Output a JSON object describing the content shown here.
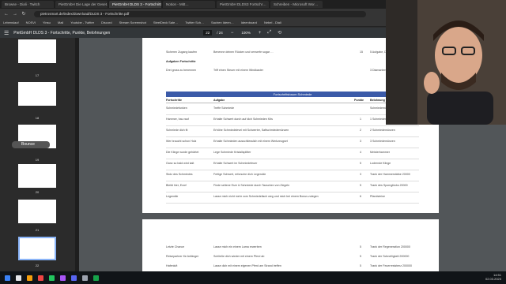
{
  "tabs": [
    "Browse - Diali · Twitch",
    "PietGmbH Die Lage der Geset…",
    "PietGmbH DLDS 3 - Fortschritte…",
    "Notion - Mitt…",
    "PietGmbH DLDS3 Fortschr…",
    "Schreiben - Microsoft Wor…"
  ],
  "address": "pietrosmart.de/index/download/DLDS 3 - Fortschritte.pdf",
  "bookmarks": [
    "Lebenslauf",
    "NOSVI",
    "Yinsu",
    "Mail",
    "Youtube - Twitter",
    "Discord",
    "Stream Screenshot",
    "SteelDeck Sale…",
    "Twitter Sch…",
    "Sachen Ideen…",
    "Ideenboard",
    "Nebel - Diali",
    "Weitere Lesezeichen"
  ],
  "pdf": {
    "title": "PietGmbH DLDS 3 - Fortschritte, Punkte, Belohnungen",
    "page_current": "22",
    "page_total": "/ 24",
    "zoom": "100%"
  },
  "thumbnails": [
    "17",
    "18",
    "19",
    "20",
    "21",
    "22"
  ],
  "badge": "Bounce",
  "top_rows": [
    {
      "task": "Sicheren Zugang kaufen",
      "desc": "Benenne deinen Rücken und verwerfe sogar …",
      "pts": "15",
      "reward": "5 Aufgabe, DLS Fahrrad"
    },
    {
      "task": "Aufgaben Fortschritte",
      "desc": "",
      "pts": "",
      "reward": ""
    },
    {
      "task": "Drei gross zu benennen",
      "desc": "Triff einen Steuer mit einem Windkaster",
      "pts": "",
      "reward": "3 Diamanten, 5 Hentai 25 Erfahrungspunkte"
    }
  ],
  "table": {
    "title": "Fortschrittsbaum Schmiede",
    "headers": [
      "Fortschritte",
      "Aufgabe",
      "Punkte",
      "Belohnung"
    ],
    "rows": [
      {
        "task": "Schmiedefunken",
        "desc": "Treffe Schmiede",
        "pts": "",
        "reward": "Schmiedemünzen"
      },
      {
        "task": "Hammer, hau rauf",
        "desc": "Erhalte Schwert durch auf dich Schmieden Kits",
        "pts": "1",
        "reward": "1 Schmiedemünzen"
      },
      {
        "task": "Schmiede dich fit",
        "desc": "Erhöhe Schmiedelevel mit Schwerter, Saftschmiedemünzen",
        "pts": "2",
        "reward": "2 Schmiedemünzen"
      },
      {
        "task": "Wer braucht schon Holz",
        "desc": "Erhalte Schmieden ausschliesslich mit einem Werkzeugset",
        "pts": "3",
        "reward": "3 Schmiedemünzen"
      },
      {
        "task": "Die Klinge wurde gehärtet",
        "desc": "Lege Schmiede Kristallsplitter",
        "pts": "4",
        "reward": "Meisterhammer"
      },
      {
        "task": "Ganz so bald wird kalt",
        "desc": "Erhalte Schwert im Schmiedefeuer",
        "pts": "5",
        "reward": "Lodernde Klinge"
      },
      {
        "task": "Stolz des Schmiedes",
        "desc": "Fertige Schwert, erforsche dich Legendär",
        "pts": "3",
        "reward": "Trank der Hammerstärke 20000"
      },
      {
        "task": "Bleibt hier, Erze!",
        "desc": "Finde seltene Erze & Schmiede durch Tauschen von Ziegeln",
        "pts": "5",
        "reward": "Trank des Spornglücks 20000"
      },
      {
        "task": "Legendär",
        "desc": "Lasse mich nicht mehr vom Schmiedetisch weg und mich bei einem Bonus zulegen",
        "pts": "6",
        "reward": "Pfandsteine"
      }
    ]
  },
  "page2_rows": [
    {
      "task": "Letzte Chance",
      "desc": "Lasse mich ein einem Lama erwerben",
      "pts": "5",
      "reward": "Trank der Regeneration 200000"
    },
    {
      "task": "Reisepartner für Anfänger",
      "desc": "Schließe dich wieder mit einem Pferd ab",
      "pts": "5",
      "reward": "Trank der Schnelligkeit 200000"
    },
    {
      "task": "Hafenluft",
      "desc": "Lasse dich mit einem eigenen Pferd am Strand treffen",
      "pts": "5",
      "reward": "Trank der Feuerresistenz 200000"
    }
  ],
  "clock": {
    "time": "14:51",
    "date": "02.03.2023"
  },
  "colors": {
    "accent": "#3b5aa8",
    "viewer_bg": "#525659"
  }
}
